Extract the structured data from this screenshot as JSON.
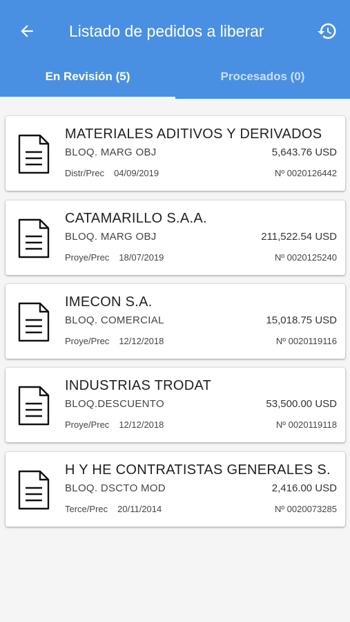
{
  "header": {
    "title": "Listado de pedidos a liberar",
    "back_icon": "arrow-back-icon",
    "history_icon": "history-icon",
    "background_color": "#4a90e2"
  },
  "tabs": [
    {
      "label": "En Revisión (5)",
      "active": true
    },
    {
      "label": "Procesados (0)",
      "active": false
    }
  ],
  "orders": [
    {
      "client": "MATERIALES ADITIVOS Y DERIVADOS",
      "status": "BLOQ. MARG OBJ",
      "amount": "5,643.76 USD",
      "type": "Distr/Prec",
      "date": "04/09/2019",
      "number": "Nº 0020126442"
    },
    {
      "client": "CATAMARILLO S.A.A.",
      "status": "BLOQ. MARG OBJ",
      "amount": "211,522.54 USD",
      "type": "Proye/Prec",
      "date": "18/07/2019",
      "number": "Nº 0020125240"
    },
    {
      "client": "IMECON S.A.",
      "status": "BLOQ. COMERCIAL",
      "amount": "15,018.75 USD",
      "type": "Proye/Prec",
      "date": "12/12/2018",
      "number": "Nº 0020119116"
    },
    {
      "client": "INDUSTRIAS TRODAT",
      "status": "BLOQ.DESCUENTO",
      "amount": "53,500.00 USD",
      "type": "Proye/Prec",
      "date": "12/12/2018",
      "number": "Nº 0020119118"
    },
    {
      "client": "H Y HE CONTRATISTAS GENERALES S.",
      "status": "BLOQ. DSCTO MOD",
      "amount": "2,416.00 USD",
      "type": "Terce/Prec",
      "date": "20/11/2014",
      "number": "Nº 0020073285"
    }
  ]
}
